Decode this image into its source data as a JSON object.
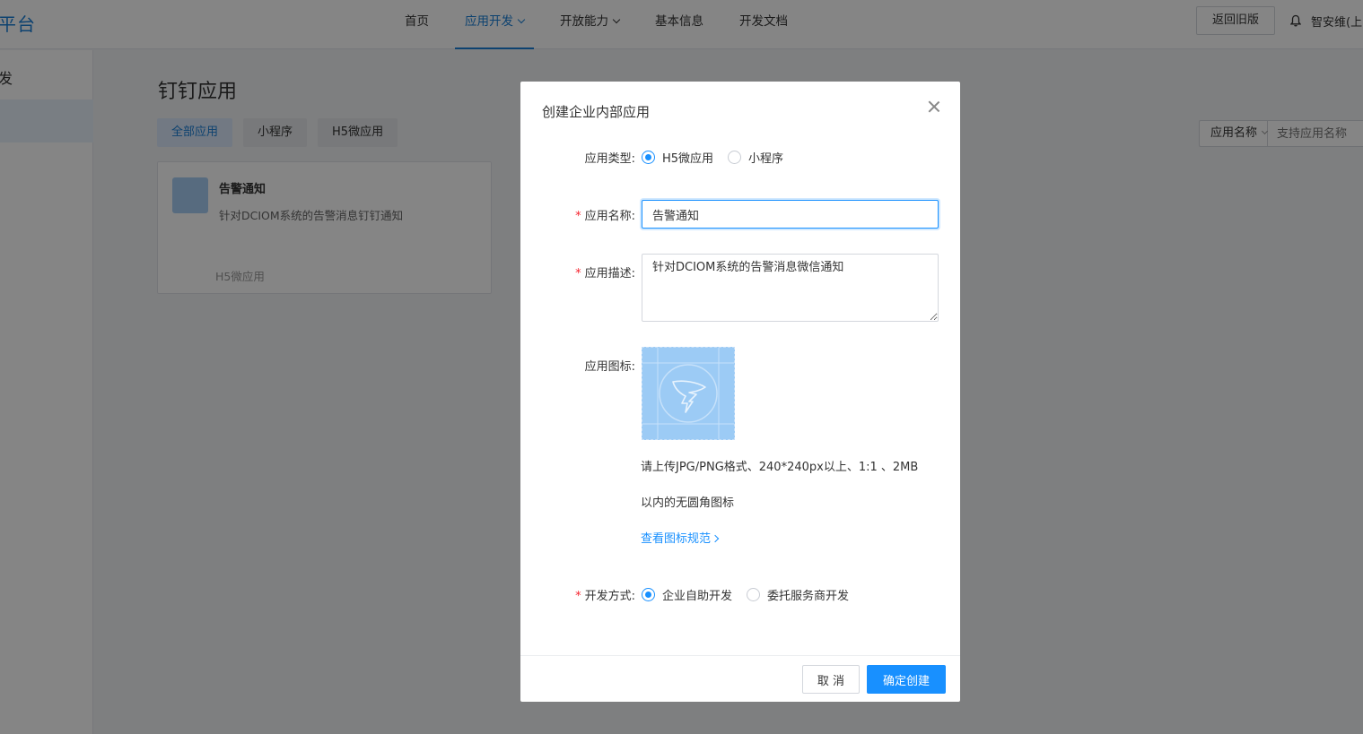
{
  "header": {
    "brand": "平台",
    "nav": [
      {
        "label": "首页",
        "dropdown": false,
        "active": false
      },
      {
        "label": "应用开发",
        "dropdown": true,
        "active": true
      },
      {
        "label": "开放能力",
        "dropdown": true,
        "active": false
      },
      {
        "label": "基本信息",
        "dropdown": false,
        "active": false
      },
      {
        "label": "开发文档",
        "dropdown": false,
        "active": false
      }
    ],
    "old_version_label": "返回旧版",
    "user_name": "智安维(上"
  },
  "sidebar": {
    "title": "发"
  },
  "main": {
    "title": "钉钉应用",
    "tabs": [
      {
        "label": "全部应用",
        "active": true
      },
      {
        "label": "小程序",
        "active": false
      },
      {
        "label": "H5微应用",
        "active": false
      }
    ],
    "search": {
      "select_label": "应用名称",
      "placeholder": "支持应用名称"
    },
    "app_card": {
      "name": "告警通知",
      "description": "针对DCIOM系统的告警消息钉钉通知",
      "type": "H5微应用"
    }
  },
  "modal": {
    "title": "创建企业内部应用",
    "app_type": {
      "label": "应用类型:",
      "options": [
        "H5微应用",
        "小程序"
      ],
      "selected": "H5微应用"
    },
    "app_name": {
      "label": "应用名称:",
      "value": "告警通知"
    },
    "app_desc": {
      "label": "应用描述:",
      "value": "针对DCIOM系统的告警消息微信通知"
    },
    "app_icon": {
      "label": "应用图标:",
      "hint_line1": "请上传JPG/PNG格式、240*240px以上、1:1 、2MB",
      "hint_line2": "以内的无圆角图标",
      "link": "查看图标规范"
    },
    "dev_mode": {
      "label": "开发方式:",
      "options": [
        "企业自助开发",
        "委托服务商开发"
      ],
      "selected": "企业自助开发"
    },
    "cancel_label": "取 消",
    "confirm_label": "确定创建"
  },
  "colors": {
    "primary": "#1890ff",
    "required": "#f5222d",
    "icon_bg": "#9ccbf5"
  }
}
